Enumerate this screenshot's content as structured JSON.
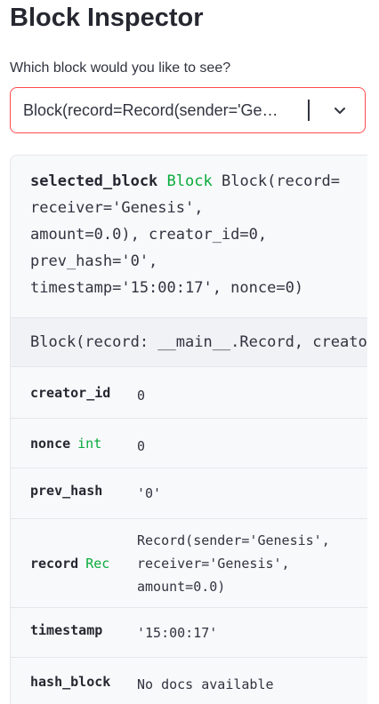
{
  "page": {
    "title": "Block Inspector"
  },
  "selector": {
    "label": "Which block would you like to see?",
    "value": "Block(record=Record(sender='Ge…",
    "accent_color": "#ff4b4b"
  },
  "inspector": {
    "var_name": "selected_block",
    "var_type": "Block",
    "repr_first": " Block(record=",
    "repr_rest": "receiver='Genesis',\namount=0.0), creator_id=0,\nprev_hash='0',\ntimestamp='15:00:17', nonce=0)",
    "doc_signature": "Block(record: __main__.Record, creator_id: int, prev_hash: str, timestamp: str, nonce: int)",
    "attributes": [
      {
        "name": "creator_id",
        "type": "",
        "value": "0"
      },
      {
        "name": "nonce",
        "type": "int",
        "value": "0"
      },
      {
        "name": "prev_hash",
        "type": "",
        "value": "'0'"
      },
      {
        "name": "record",
        "type": "Rec",
        "value": "Record(sender='Genesis',\nreceiver='Genesis',\namount=0.0)"
      },
      {
        "name": "timestamp",
        "type": "",
        "value": "'15:00:17'"
      },
      {
        "name": "hash_block",
        "type": "",
        "value": "No docs available"
      }
    ],
    "type_color": "#09ab3b"
  },
  "icons": {
    "dropdown": "chevron-down-icon"
  }
}
